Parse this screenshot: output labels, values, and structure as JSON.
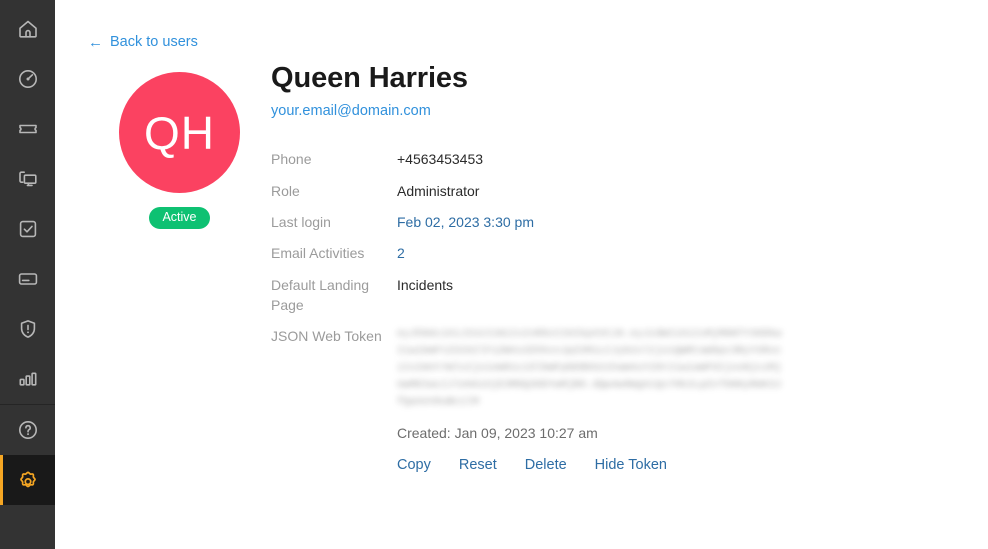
{
  "sidebar": {
    "items": [
      {
        "name": "home",
        "icon": "home-icon",
        "active": false
      },
      {
        "name": "dashboard",
        "icon": "gauge-icon",
        "active": false
      },
      {
        "name": "tickets",
        "icon": "ticket-icon",
        "active": false
      },
      {
        "name": "assets",
        "icon": "monitor-folder-icon",
        "active": false
      },
      {
        "name": "tasks",
        "icon": "checkbox-icon",
        "active": false
      },
      {
        "name": "billing",
        "icon": "card-icon",
        "active": false
      },
      {
        "name": "incidents",
        "icon": "shield-alert-icon",
        "active": false
      },
      {
        "name": "reports",
        "icon": "bar-chart-icon",
        "active": false
      },
      {
        "name": "help",
        "icon": "help-circle-icon",
        "active": false
      },
      {
        "name": "settings",
        "icon": "gear-icon",
        "active": true
      }
    ]
  },
  "back_link": {
    "label": "Back to users",
    "arrow": "←"
  },
  "profile": {
    "initials": "QH",
    "status": "Active",
    "name": "Queen Harries",
    "email": "your.email@domain.com"
  },
  "details": [
    {
      "label": "Phone",
      "value": "+4563453453",
      "style": "plain"
    },
    {
      "label": "Role",
      "value": "Administrator",
      "style": "plain"
    },
    {
      "label": "Last login",
      "value": "Feb 02, 2023  3:30 pm",
      "style": "blue"
    },
    {
      "label": "Email Activities",
      "value": "2",
      "style": "blue-link"
    },
    {
      "label": "Default Landing Page",
      "value": "Incidents",
      "style": "plain"
    }
  ],
  "token": {
    "label": "JSON Web Token",
    "value": "eyJhbGciOiJIUzI1NiIsInR5cCI6IkpXVCJ9.eyJzdWIiOiIxMjM0NTY3ODkwIiwibmFtZSI6IlF1ZWVuIEhhcnJpZXMiLCJyb2xlIjoiQWRtaW5pc3RyYXRvciIsImVtYWlsIjoieW91ci5lbWFpbEBkb21haW4uY29tIiwiaWF0IjoxNjczMjUwMDIwLCJleHAiOjE3MDQ3ODYwMjB9.dQw4w9WgXcQs7Hk2LpZvTbN6yRmK3JfQaXeV0uBc1lM",
    "created": "Created: Jan 09, 2023 10:27 am",
    "actions": [
      {
        "label": "Copy"
      },
      {
        "label": "Reset"
      },
      {
        "label": "Delete"
      },
      {
        "label": "Hide Token"
      }
    ]
  },
  "colors": {
    "sidebar_bg": "#333333",
    "sidebar_active_bg": "#191919",
    "accent_orange": "#f5a623",
    "avatar_pink": "#fb4261",
    "status_green": "#0ec172",
    "link_blue": "#3191dc",
    "value_blue": "#2e6da4"
  }
}
